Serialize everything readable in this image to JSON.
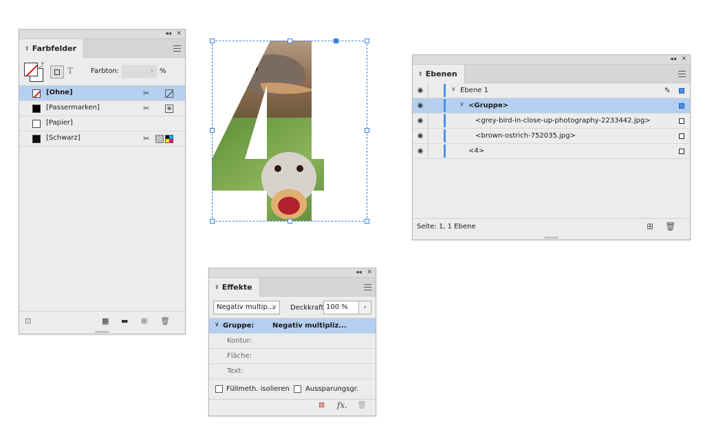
{
  "swatches_panel": {
    "tab_label": "Farbfelder",
    "collapse_glyph": "◂◂",
    "close_glyph": "✕",
    "farbton_label": "Farbton:",
    "farbton_arrow": "›",
    "farbton_unit": "%",
    "text_toggle": "T",
    "items": [
      {
        "name": "[Ohne]",
        "selected": true
      },
      {
        "name": "[Passermarken]",
        "selected": false
      },
      {
        "name": "[Papier]",
        "selected": false
      },
      {
        "name": "[Schwarz]",
        "selected": false
      }
    ]
  },
  "layers_panel": {
    "tab_label": "Ebenen",
    "collapse_glyph": "◂◂",
    "close_glyph": "✕",
    "rows": [
      {
        "label": "Ebene 1",
        "chevron": "∨"
      },
      {
        "label": "<Gruppe>",
        "chevron": "∨"
      },
      {
        "label": "<grey-bird-in-close-up-photography-2233442.jpg>"
      },
      {
        "label": "<brown-ostrich-752035.jpg>"
      },
      {
        "label": "<4>"
      }
    ],
    "status": "Seite: 1, 1 Ebene"
  },
  "effects_panel": {
    "tab_label": "Effekte",
    "collapse_glyph": "◂◂",
    "close_glyph": "✕",
    "blend_mode": "Negativ multip...",
    "opacity_label": "Deckkraft:",
    "opacity_value": "100 %",
    "opacity_arrow": "›",
    "rows": [
      {
        "key": "Gruppe:",
        "value": "Negativ multipliz..."
      },
      {
        "key": "Kontur:",
        "value": ""
      },
      {
        "key": "Fläche:",
        "value": ""
      },
      {
        "key": "Text:",
        "value": ""
      }
    ],
    "isolate_label": "Füllmeth. isolieren",
    "knockout_label": "Aussparungsgr.",
    "fx_label": "fx."
  },
  "colors": {
    "selection_blue": "#b5cff0",
    "layer_color": "#4c8ee8",
    "frame_blue": "#3a7fd6"
  }
}
